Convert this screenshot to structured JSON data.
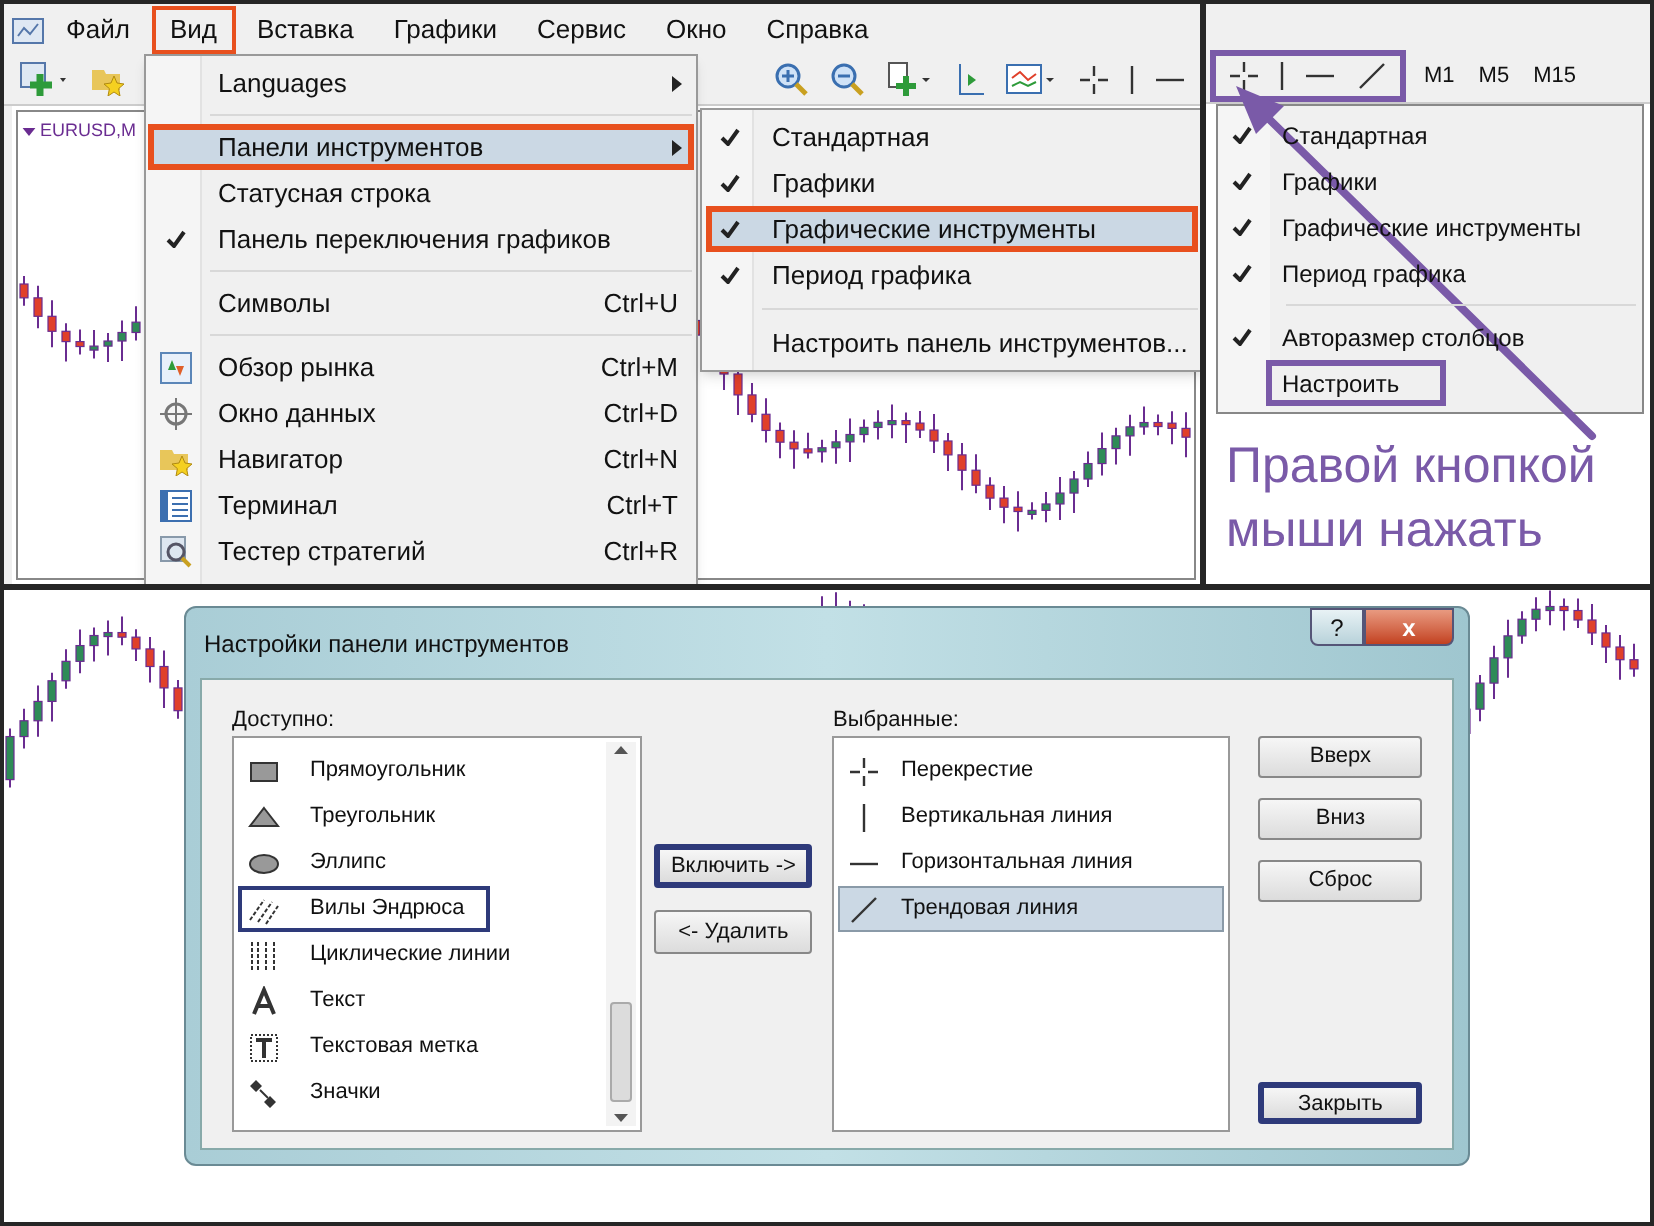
{
  "menubar": [
    {
      "label": "Файл",
      "highlighted": false
    },
    {
      "label": "Вид",
      "highlighted": true
    },
    {
      "label": "Вставка",
      "highlighted": false
    },
    {
      "label": "Графики",
      "highlighted": false
    },
    {
      "label": "Сервис",
      "highlighted": false
    },
    {
      "label": "Окно",
      "highlighted": false
    },
    {
      "label": "Справка",
      "highlighted": false
    }
  ],
  "chart": {
    "symbol": "EURUSD,M"
  },
  "view_menu": [
    {
      "kind": "item",
      "label": "Languages",
      "submenu": true,
      "checked": false,
      "selected": false,
      "highlighted": false
    },
    {
      "kind": "separator"
    },
    {
      "kind": "item",
      "label": "Панели инструментов",
      "submenu": true,
      "checked": false,
      "selected": true,
      "highlighted": true
    },
    {
      "kind": "item",
      "label": "Статусная строка",
      "submenu": false,
      "checked": false,
      "selected": false,
      "highlighted": false
    },
    {
      "kind": "item",
      "label": "Панель переключения графиков",
      "submenu": false,
      "checked": true,
      "selected": false,
      "highlighted": false
    },
    {
      "kind": "separator"
    },
    {
      "kind": "item",
      "label": "Символы",
      "shortcut": "Ctrl+U",
      "submenu": false,
      "checked": false,
      "selected": false,
      "highlighted": false
    },
    {
      "kind": "separator"
    },
    {
      "kind": "item",
      "label": "Обзор рынка",
      "shortcut": "Ctrl+M",
      "submenu": false,
      "checked": false,
      "selected": false,
      "highlighted": false
    },
    {
      "kind": "item",
      "label": "Окно данных",
      "shortcut": "Ctrl+D",
      "submenu": false,
      "checked": false,
      "selected": false,
      "highlighted": false
    },
    {
      "kind": "item",
      "label": "Навигатор",
      "shortcut": "Ctrl+N",
      "submenu": false,
      "checked": false,
      "selected": false,
      "highlighted": false
    },
    {
      "kind": "item",
      "label": "Терминал",
      "shortcut": "Ctrl+T",
      "submenu": false,
      "checked": false,
      "selected": false,
      "highlighted": false
    },
    {
      "kind": "item",
      "label": "Тестер стратегий",
      "shortcut": "Ctrl+R",
      "submenu": false,
      "checked": false,
      "selected": false,
      "highlighted": false
    }
  ],
  "toolbars_submenu": [
    {
      "kind": "item",
      "label": "Стандартная",
      "checked": true,
      "highlighted": false
    },
    {
      "kind": "item",
      "label": "Графики",
      "checked": true,
      "highlighted": false
    },
    {
      "kind": "item",
      "label": "Графические инструменты",
      "checked": true,
      "highlighted": true
    },
    {
      "kind": "item",
      "label": "Период графика",
      "checked": true,
      "highlighted": false
    },
    {
      "kind": "separator"
    },
    {
      "kind": "item",
      "label": "Настроить панель инструментов...",
      "checked": false,
      "highlighted": false
    }
  ],
  "drawing_toolbar": {
    "highlighted": true
  },
  "period_buttons": [
    "M1",
    "M5",
    "M15"
  ],
  "context_menu": [
    {
      "kind": "item",
      "label": "Стандартная",
      "checked": true,
      "highlighted": false
    },
    {
      "kind": "item",
      "label": "Графики",
      "checked": true,
      "highlighted": false
    },
    {
      "kind": "item",
      "label": "Графические инструменты",
      "checked": true,
      "highlighted": false
    },
    {
      "kind": "item",
      "label": "Период графика",
      "checked": true,
      "highlighted": false
    },
    {
      "kind": "separator"
    },
    {
      "kind": "item",
      "label": "Авторазмер столбцов",
      "checked": true,
      "highlighted": false
    },
    {
      "kind": "item",
      "label": "Настроить",
      "checked": false,
      "highlighted": true
    }
  ],
  "hint": "Правой кнопкой мыши нажать",
  "dialog": {
    "title": "Настройки панели инструментов",
    "help": "?",
    "close": "x",
    "available_label": "Доступно:",
    "available": [
      {
        "label": "Прямоугольник",
        "highlighted": false
      },
      {
        "label": "Треугольник",
        "highlighted": false
      },
      {
        "label": "Эллипс",
        "highlighted": false
      },
      {
        "label": "Вилы Эндрюса",
        "highlighted": true
      },
      {
        "label": "Циклические линии",
        "highlighted": false
      },
      {
        "label": "Текст",
        "highlighted": false
      },
      {
        "label": "Текстовая метка",
        "highlighted": false
      },
      {
        "label": "Значки",
        "highlighted": false
      }
    ],
    "include_button": {
      "label": "Включить ->",
      "highlighted": true
    },
    "remove_button": {
      "label": "<- Удалить",
      "highlighted": false
    },
    "selected_label": "Выбранные:",
    "selected_items": [
      {
        "label": "Перекрестие",
        "selected": false
      },
      {
        "label": "Вертикальная линия",
        "selected": false
      },
      {
        "label": "Горизонтальная линия",
        "selected": false
      },
      {
        "label": "Трендовая линия",
        "selected": true
      }
    ],
    "side_buttons": [
      {
        "label": "Вверх",
        "highlighted": false
      },
      {
        "label": "Вниз",
        "highlighted": false
      },
      {
        "label": "Сброс",
        "highlighted": false
      },
      {
        "label": "Закрыть",
        "highlighted": true
      }
    ]
  }
}
